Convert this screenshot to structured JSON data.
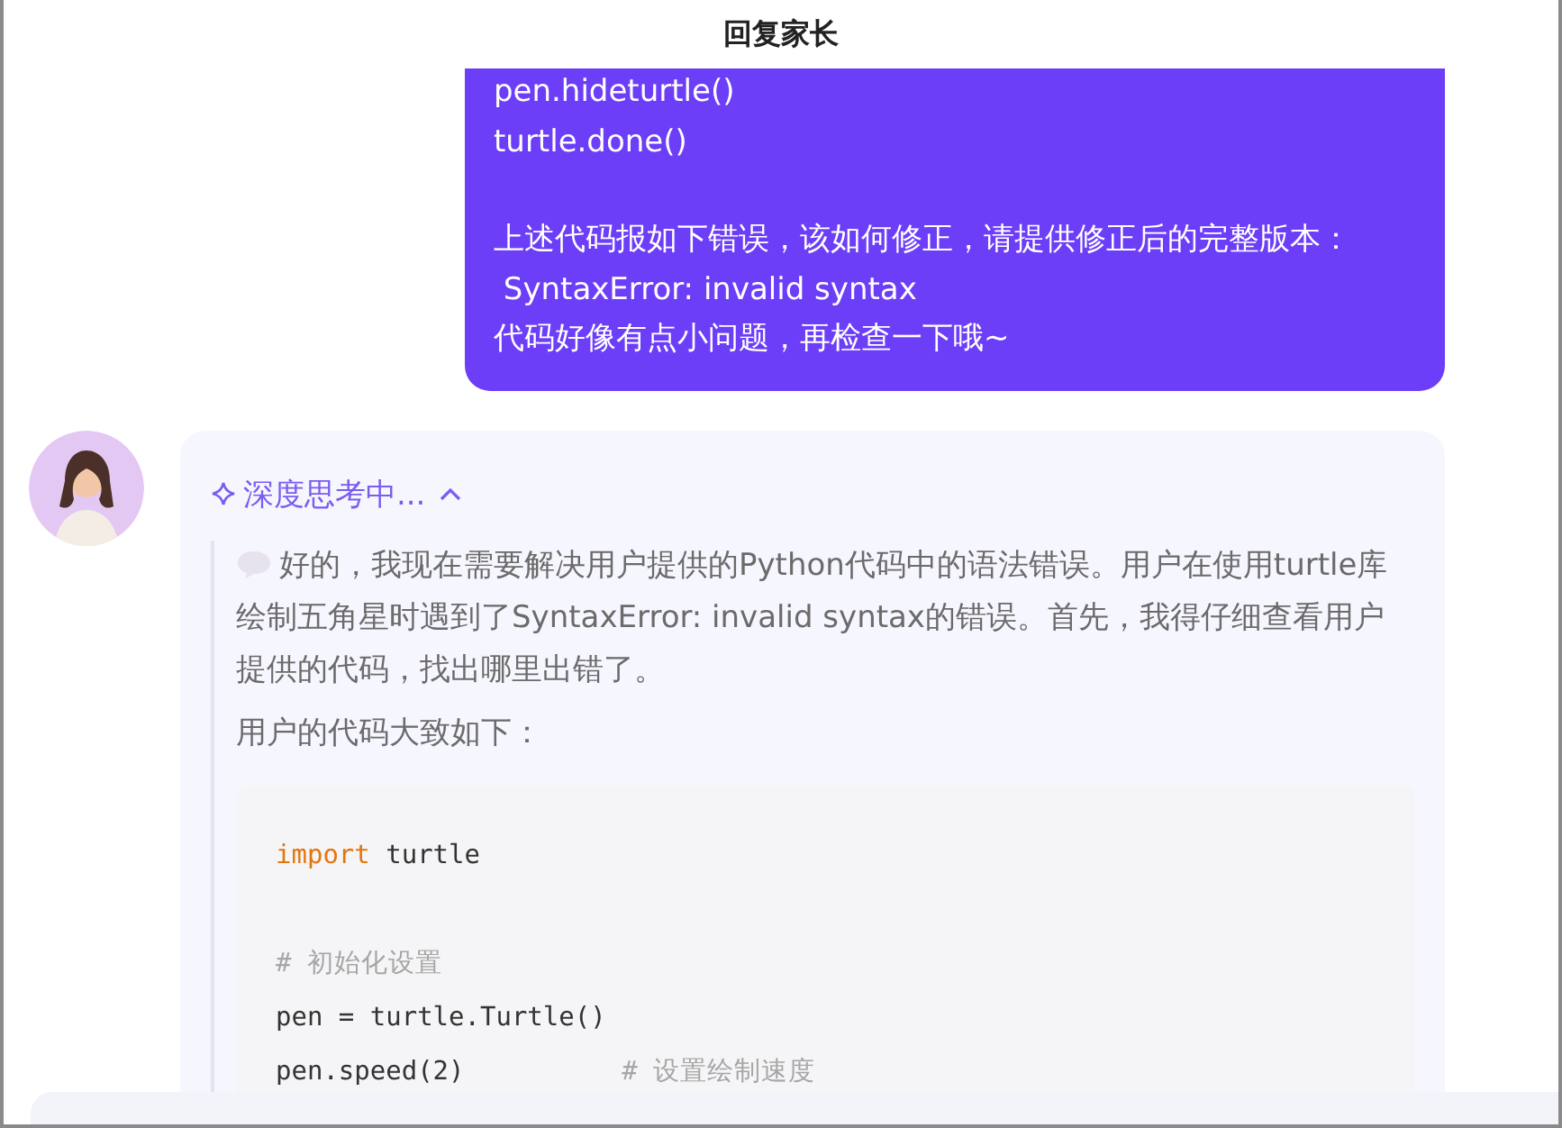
{
  "header": {
    "title": "回复家长"
  },
  "user_message": {
    "paragraphs": [
      [
        "pen.hideturtle()",
        "turtle.done()"
      ],
      [
        "上述代码报如下错误，该如何修正，请提供修正后的完整版本：",
        " SyntaxError: invalid syntax",
        "代码好像有点小问题，再检查一下哦~"
      ]
    ]
  },
  "assistant_message": {
    "thinking": {
      "label": "深度思考中...",
      "expanded": true,
      "paragraphs": [
        "好的，我现在需要解决用户提供的Python代码中的语法错误。用户在使用turtle库绘制五角星时遇到了SyntaxError: invalid syntax的错误。首先，我得仔细查看用户提供的代码，找出哪里出错了。",
        "用户的代码大致如下："
      ],
      "code_lines": [
        {
          "kind": "code",
          "segments": [
            {
              "kind": "keyword",
              "text": "import"
            },
            {
              "kind": "plain",
              "text": " turtle"
            }
          ]
        },
        {
          "kind": "blank"
        },
        {
          "kind": "code",
          "segments": [
            {
              "kind": "comment",
              "text": "# 初始化设置"
            }
          ]
        },
        {
          "kind": "code",
          "segments": [
            {
              "kind": "plain",
              "text": "pen = turtle.Turtle()"
            }
          ]
        },
        {
          "kind": "code",
          "segments": [
            {
              "kind": "plain",
              "text": "pen.speed(2)          "
            },
            {
              "kind": "comment",
              "text": "# 设置绘制速度"
            }
          ]
        }
      ]
    }
  }
}
